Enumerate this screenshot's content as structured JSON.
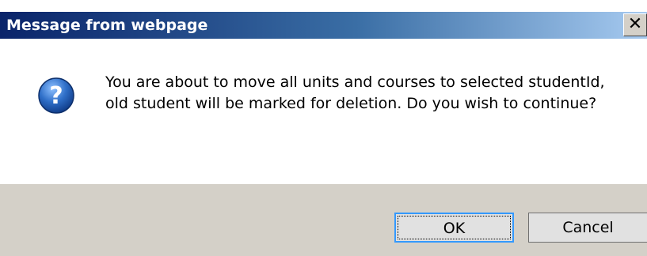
{
  "window": {
    "title": "Message from webpage",
    "close_glyph": "✕"
  },
  "message": {
    "icon": "question-icon",
    "text": "You are about to move all units and courses to selected studentId, old student will be marked for deletion. Do you wish to continue?"
  },
  "buttons": {
    "ok_label": "OK",
    "cancel_label": "Cancel"
  },
  "colors": {
    "title_start": "#0a246a",
    "title_end": "#a6caf0",
    "footer_bg": "#d4d0c8",
    "icon_blue": "#2f6fc8"
  }
}
